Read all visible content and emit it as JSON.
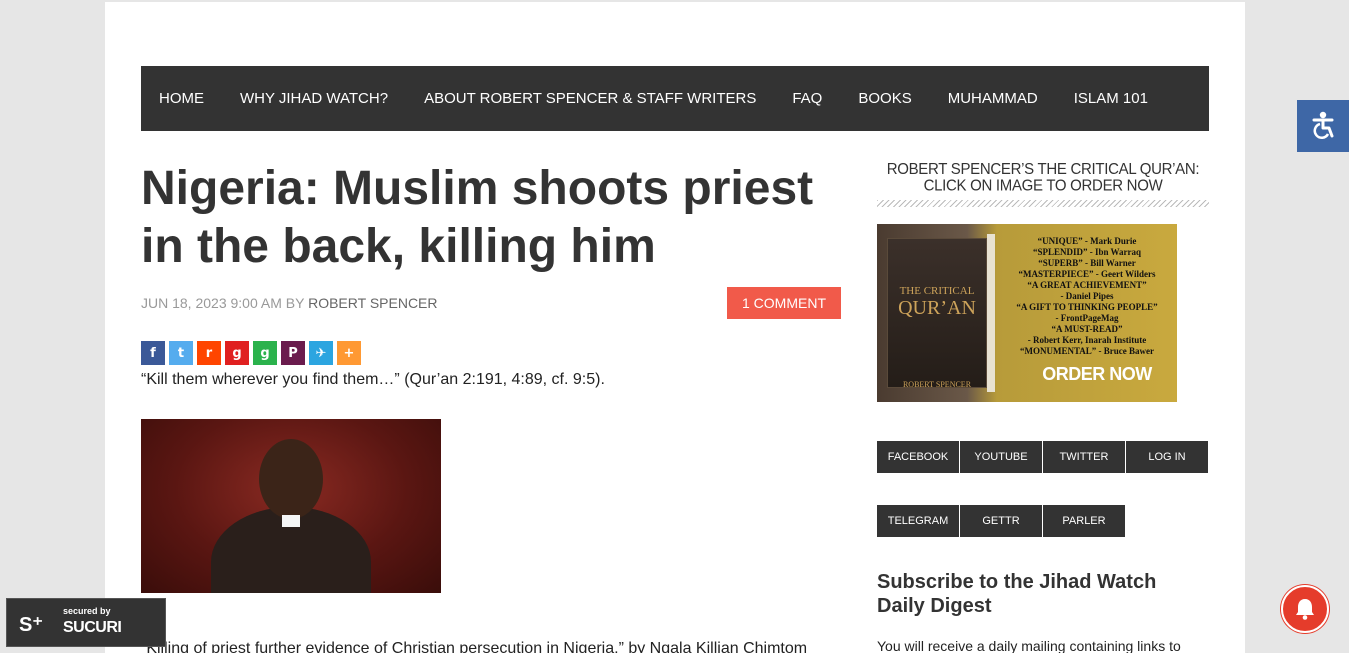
{
  "nav": {
    "items": [
      {
        "label": "HOME"
      },
      {
        "label": "WHY JIHAD WATCH?"
      },
      {
        "label": "ABOUT ROBERT SPENCER & STAFF WRITERS"
      },
      {
        "label": "FAQ"
      },
      {
        "label": "BOOKS"
      },
      {
        "label": "MUHAMMAD"
      },
      {
        "label": "ISLAM 101"
      }
    ]
  },
  "article": {
    "title": "Nigeria: Muslim shoots priest in the back, killing him",
    "date": "JUN 18, 2023 9:00 AM",
    "by": "BY",
    "author": "ROBERT SPENCER",
    "comments": "1 COMMENT",
    "quote": "“Kill them wherever you find them…” (Qur’an 2:191, 4:89, cf. 9:5).",
    "excerpt": "“Killing of priest further evidence of Christian persecution in Nigeria,” by Ngala Killian Chimtom"
  },
  "share": {
    "icons": [
      "facebook-icon",
      "twitter-icon",
      "reddit-icon",
      "gab-icon",
      "gettr-icon",
      "parler-icon",
      "telegram-icon",
      "more-icon"
    ],
    "colors": [
      "#3b5998",
      "#55acee",
      "#ff4500",
      "#e02020",
      "#2bb24c",
      "#6a1b4d",
      "#2ca5e0",
      "#ff9933"
    ],
    "glyphs": [
      "f",
      "t",
      "r",
      "g",
      "g",
      "P",
      "✈",
      "+"
    ]
  },
  "sidebar": {
    "book_title": "ROBERT SPENCER’S THE CRITICAL QUR’AN: CLICK ON IMAGE TO ORDER NOW",
    "book": {
      "cover_line1": "THE CRITICAL",
      "cover_line2": "QUR’AN",
      "cover_author": "ROBERT SPENCER",
      "praise": [
        "“UNIQUE” - Mark Durie",
        "“SPLENDID” - Ibn Warraq",
        "“SUPERB” - Bill Warner",
        "“MASTERPIECE” - Geert Wilders",
        "“A GREAT ACHIEVEMENT”",
        "- Daniel Pipes",
        "“A GIFT TO THINKING PEOPLE”",
        "- FrontPageMag",
        "“A MUST-READ”",
        "- Robert Kerr, Inarah Institute",
        "“MONUMENTAL” - Bruce Bawer"
      ],
      "order": "ORDER NOW"
    },
    "social_row1": [
      "FACEBOOK",
      "YOUTUBE",
      "TWITTER",
      "LOG IN"
    ],
    "social_row2": [
      "TELEGRAM",
      "GETTR",
      "PARLER"
    ],
    "subscribe_title": "Subscribe to the Jihad Watch Daily Digest",
    "subscribe_text": "You will receive a daily mailing containing links to"
  },
  "badge": {
    "secured": "secured by",
    "brand": "SUCURI"
  }
}
